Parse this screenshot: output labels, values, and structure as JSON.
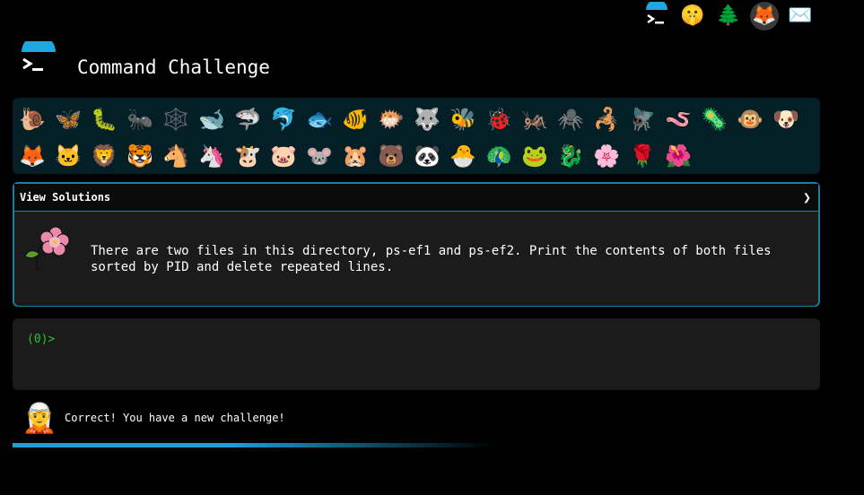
{
  "app": {
    "title": "Command Challenge"
  },
  "top_nav": [
    {
      "name": "terminal-logo-icon"
    },
    {
      "name": "shushing-face-icon",
      "glyph": "🤫"
    },
    {
      "name": "evergreen-tree-icon",
      "glyph": "🌲"
    },
    {
      "name": "gitlab-fox-icon",
      "glyph": "🦊"
    },
    {
      "name": "envelope-icon",
      "glyph": "✉️"
    }
  ],
  "animals": [
    {
      "name": "snail",
      "glyph": "🐌"
    },
    {
      "name": "butterfly",
      "glyph": "🦋"
    },
    {
      "name": "caterpillar",
      "glyph": "🐛"
    },
    {
      "name": "ant",
      "glyph": "🐜"
    },
    {
      "name": "spider-web",
      "glyph": "🕸️"
    },
    {
      "name": "whale",
      "glyph": "🐋"
    },
    {
      "name": "shark",
      "glyph": "🦈"
    },
    {
      "name": "dolphin",
      "glyph": "🐬"
    },
    {
      "name": "fish",
      "glyph": "🐟"
    },
    {
      "name": "tropical-fish",
      "glyph": "🐠"
    },
    {
      "name": "blowfish",
      "glyph": "🐡"
    },
    {
      "name": "wolf",
      "glyph": "🐺"
    },
    {
      "name": "bee",
      "glyph": "🐝"
    },
    {
      "name": "ladybug",
      "glyph": "🐞"
    },
    {
      "name": "cricket",
      "glyph": "🦗"
    },
    {
      "name": "spider",
      "glyph": "🕷️"
    },
    {
      "name": "scorpion",
      "glyph": "🦂"
    },
    {
      "name": "fly",
      "glyph": "🪰"
    },
    {
      "name": "worm",
      "glyph": "🪱"
    },
    {
      "name": "microbe",
      "glyph": "🦠"
    },
    {
      "name": "monkey",
      "glyph": "🐵"
    },
    {
      "name": "dog",
      "glyph": "🐶"
    },
    {
      "name": "fox",
      "glyph": "🦊"
    },
    {
      "name": "cat",
      "glyph": "🐱"
    },
    {
      "name": "lion",
      "glyph": "🦁"
    },
    {
      "name": "tiger",
      "glyph": "🐯"
    },
    {
      "name": "horse",
      "glyph": "🐴"
    },
    {
      "name": "unicorn",
      "glyph": "🦄"
    },
    {
      "name": "cow",
      "glyph": "🐮"
    },
    {
      "name": "pig",
      "glyph": "🐷"
    },
    {
      "name": "mouse",
      "glyph": "🐭"
    },
    {
      "name": "hamster",
      "glyph": "🐹"
    },
    {
      "name": "bear",
      "glyph": "🐻"
    },
    {
      "name": "panda",
      "glyph": "🐼"
    },
    {
      "name": "hatching-chick",
      "glyph": "🐣"
    },
    {
      "name": "peacock",
      "glyph": "🦚"
    },
    {
      "name": "frog",
      "glyph": "🐸"
    },
    {
      "name": "dragon",
      "glyph": "🐉"
    },
    {
      "name": "cherry-blossom",
      "glyph": "🌸"
    },
    {
      "name": "rose",
      "glyph": "🌹"
    },
    {
      "name": "hibiscus",
      "glyph": "🌺"
    }
  ],
  "solutions": {
    "header": "View Solutions",
    "chevron": "❯",
    "challenge_text": "There are two files in this directory, ps-ef1 and ps-ef2. Print the contents of both files sorted by PID and delete repeated lines."
  },
  "terminal": {
    "prompt": "(0)>"
  },
  "status": {
    "elf_glyph": "🧝",
    "message": "Correct! You have a new challenge!"
  },
  "colors": {
    "accent": "#1b7fa0",
    "prompt": "#26c526",
    "panel_bg": "#1b1b1b",
    "animals_bg": "#051f27"
  }
}
